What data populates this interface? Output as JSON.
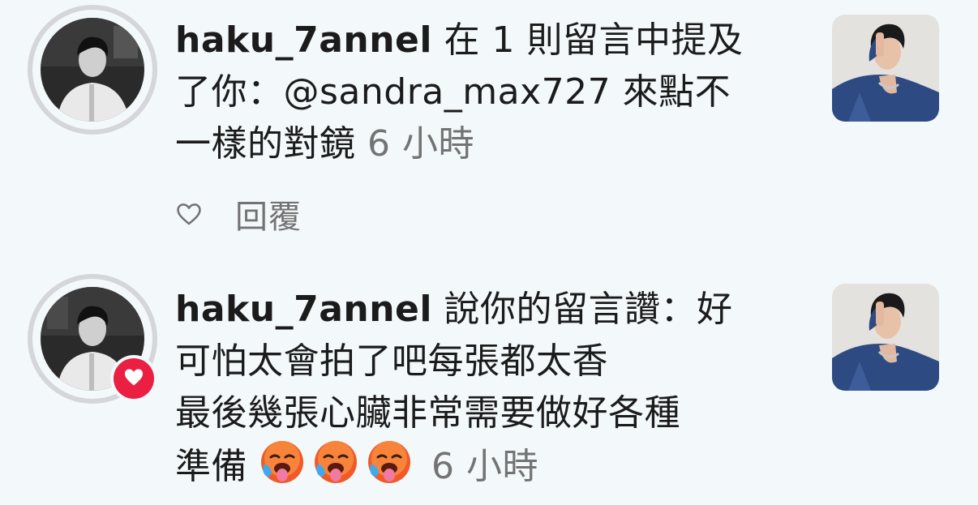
{
  "notifications": [
    {
      "username": "haku_7annel",
      "lines": [
        "在 1 則留言中提及",
        "了你：@sandra_max727 來點不",
        "一樣的對鏡"
      ],
      "time": "6 小時",
      "actions": {
        "like_icon": "heart-outline-icon",
        "reply_label": "回覆"
      }
    },
    {
      "username": "haku_7annel",
      "lines": [
        "說你的留言讚：好",
        "可怕太會拍了吧每張都太香",
        "最後幾張心臟非常需要做好各種",
        "準備"
      ],
      "emoji": [
        "hot-face-emoji",
        "hot-face-emoji",
        "hot-face-emoji"
      ],
      "time": "6 小時",
      "badge_icon": "heart-filled-icon"
    }
  ],
  "colors": {
    "background": "#f3f8fb",
    "time_gray": "#737373",
    "badge_red": "#ea1f42"
  }
}
